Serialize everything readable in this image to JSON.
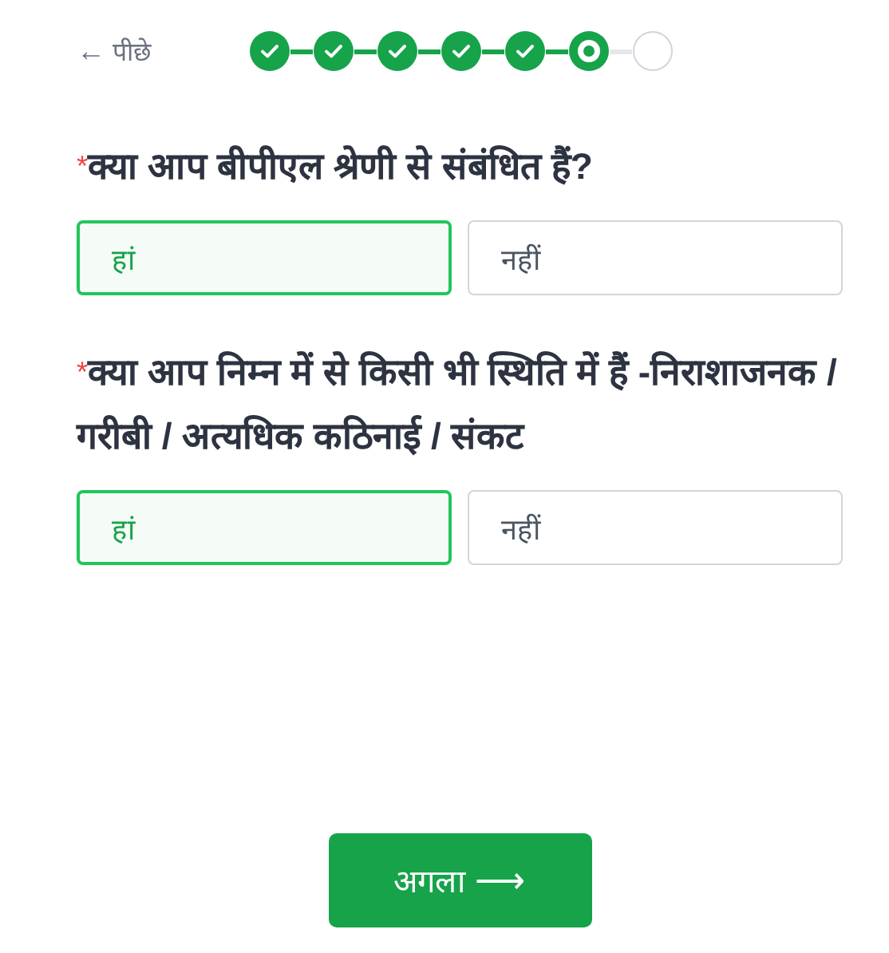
{
  "back": {
    "arrow": "←",
    "label": "पीछे"
  },
  "steps": [
    {
      "kind": "done"
    },
    {
      "kind": "done"
    },
    {
      "kind": "done"
    },
    {
      "kind": "done"
    },
    {
      "kind": "done"
    },
    {
      "kind": "current"
    },
    {
      "kind": "todo"
    }
  ],
  "questions": [
    {
      "mark": "*",
      "text": "क्या आप बीपीएल श्रेणी से संबंधित हैं?",
      "options": [
        {
          "label": "हां",
          "selected": true
        },
        {
          "label": "नहीं",
          "selected": false
        }
      ]
    },
    {
      "mark": "*",
      "text": "क्या आप निम्न में से किसी भी स्थिति में हैं -निराशाजनक / गरीबी / अत्यधिक कठिनाई / संकट",
      "options": [
        {
          "label": "हां",
          "selected": true
        },
        {
          "label": "नहीं",
          "selected": false
        }
      ]
    }
  ],
  "next": {
    "label": "अगला",
    "arrow": "⟶"
  }
}
